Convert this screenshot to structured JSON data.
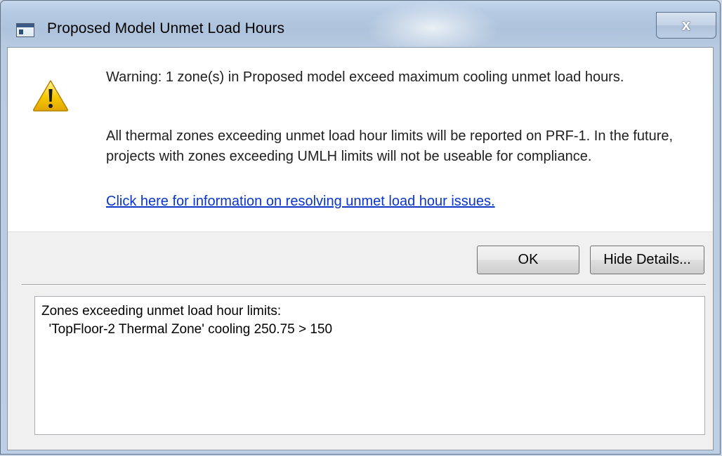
{
  "window": {
    "title": "Proposed Model Unmet Load Hours",
    "close_glyph": "x"
  },
  "message": {
    "warning": "Warning: 1 zone(s) in Proposed model exceed maximum cooling unmet load hours.",
    "body": "All thermal zones exceeding unmet load hour limits will be reported on PRF-1. In the future, projects with zones exceeding UMLH limits will not be useable for compliance.",
    "link": "Click here for information on resolving unmet load hour issues."
  },
  "buttons": {
    "ok_label": "OK",
    "hide_details_label": "Hide Details..."
  },
  "details": {
    "heading": "Zones exceeding unmet load hour limits:",
    "lines": [
      "  'TopFloor-2 Thermal Zone' cooling 250.75 > 150"
    ]
  },
  "icons": {
    "app": "app-window-icon",
    "warning": "warning-icon",
    "close": "close-icon"
  },
  "colors": {
    "link": "#0a35c7",
    "warning_fill": "#f5c800",
    "title_bar": "#b4c9e2"
  }
}
